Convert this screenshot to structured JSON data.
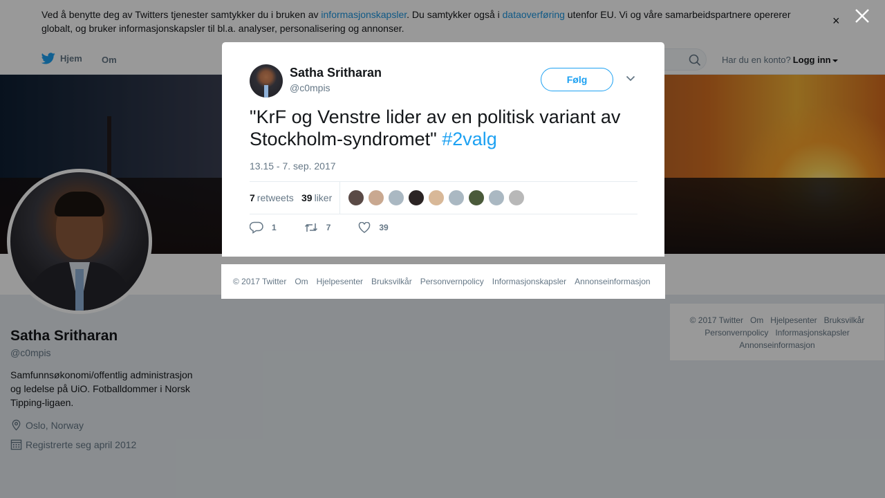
{
  "cookie": {
    "text_1": "Ved å benytte deg av Twitters tjenester samtykker du i bruken av ",
    "link_1": "informasjonskapsler",
    "text_2": ". Du samtykker også i ",
    "link_2": "dataoverføring",
    "text_3": " utenfor EU. Vi og våre samarbeidspartnere opererer globalt, og bruker informasjonskapsler til bl.a. analyser, personalisering og annonser.",
    "close": "×"
  },
  "nav": {
    "home": "Hjem",
    "about": "Om",
    "login_prompt": "Har du en konto?",
    "login": "Logg inn"
  },
  "profile": {
    "name": "Satha Sritharan",
    "handle": "@c0mpis",
    "bio": "Samfunnsøkonomi/offentlig administrasjon og ledelse på UiO. Fotballdommer i Norsk Tipping-ligaen.",
    "location": "Oslo, Norway",
    "joined": "Registrerte seg april 2012"
  },
  "tweet": {
    "name": "Satha Sritharan",
    "handle": "@c0mpis",
    "follow": "Følg",
    "text": "\"KrF og Venstre lider av en politisk variant av Stockholm-syndromet\" ",
    "hashtag": "#2valg",
    "time": "13.15 - 7. sep. 2017",
    "retweets_count": "7",
    "retweets_label": "retweets",
    "likes_count": "39",
    "likes_label": "liker",
    "replies": "1",
    "retweet_action": "7",
    "like_action": "39",
    "liker_colors": [
      "#5a4a46",
      "#c9a890",
      "#aab8c2",
      "#2b2424",
      "#d8b898",
      "#aab8c2",
      "#4a5a3a",
      "#aab8c2",
      "#b8b8b8"
    ]
  },
  "footer": {
    "copyright": "© 2017 Twitter",
    "about": "Om",
    "help": "Hjelpesenter",
    "terms": "Bruksvilkår",
    "privacy": "Personvernpolicy",
    "cookies": "Informasjonskapsler",
    "ads": "Annonseinformasjon"
  },
  "colors": {
    "accent": "#1da1f2",
    "link": "#1b95e0",
    "muted": "#657786"
  }
}
